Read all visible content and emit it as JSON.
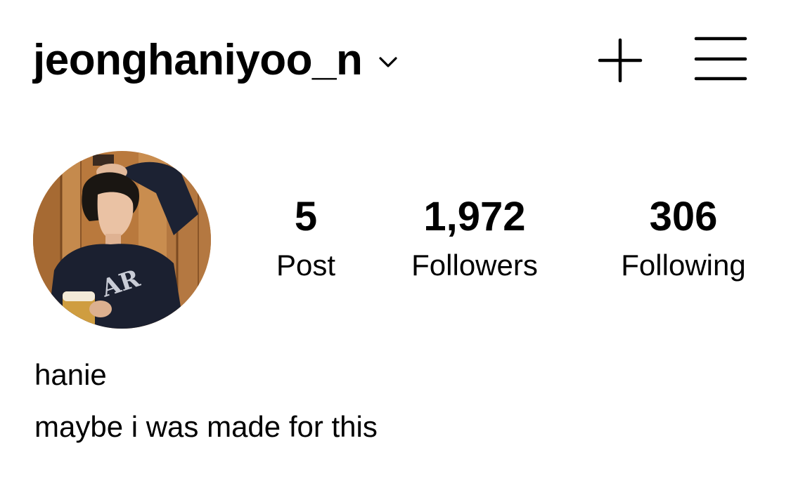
{
  "header": {
    "username": "jeonghaniyoo_n",
    "icons": {
      "dropdown": "chevron-down-icon",
      "create": "plus-icon",
      "menu": "hamburger-menu-icon"
    }
  },
  "profile": {
    "avatar_icon": "profile-photo",
    "stats": [
      {
        "value": "5",
        "label": "Post"
      },
      {
        "value": "1,972",
        "label": "Followers"
      },
      {
        "value": "306",
        "label": "Following"
      }
    ],
    "name": "hanie",
    "bio": "maybe i was made for this"
  },
  "colors": {
    "text": "#000000",
    "background": "#ffffff"
  }
}
